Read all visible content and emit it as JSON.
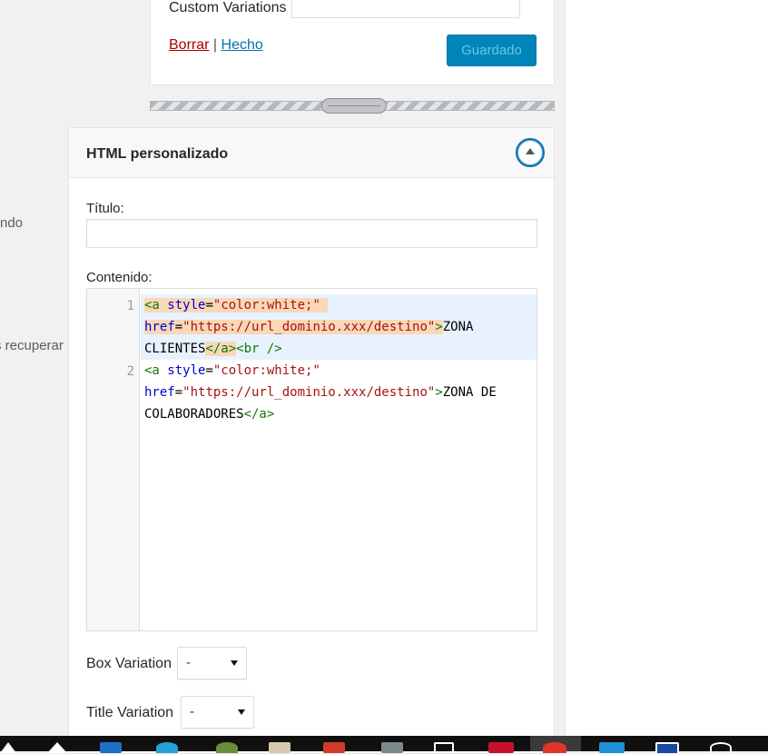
{
  "background_text": {
    "line1": "ndo",
    "line2": "s recuperar"
  },
  "previous_widget": {
    "custom_variations_label": "Custom Variations",
    "custom_variations_value": "",
    "delete_link": "Borrar",
    "separator": "|",
    "done_link": "Hecho",
    "save_button": "Guardado"
  },
  "widget": {
    "title": "HTML personalizado",
    "title_field_label": "Título:",
    "title_field_value": "",
    "content_field_label": "Contenido:",
    "box_variation_label": "Box Variation",
    "box_variation_value": "-",
    "title_variation_label": "Title Variation",
    "title_variation_value": "-"
  },
  "code_editor": {
    "line_numbers": [
      "1",
      "2"
    ],
    "lines": [
      {
        "row1": {
          "t1": "<a",
          "a1": " style",
          "e1": "=",
          "s1": "\"color:white;\" "
        },
        "row2": {
          "a1": "href",
          "e1": "=",
          "s1": "\"https://url_dominio.xxx/destino\"",
          "t1": ">",
          "x1": "ZONA"
        },
        "row3": {
          "x1": "CLIENTES",
          "t1": "</a>",
          "t2": "<br />"
        }
      },
      {
        "row1": {
          "t1": "<a",
          "a1": " style",
          "e1": "=",
          "s1": "\"color:white;\""
        },
        "row2": {
          "a1": "href",
          "e1": "=",
          "s1": "\"https://url_dominio.xxx/destino\"",
          "t1": ">",
          "x1": "ZONA DE"
        },
        "row3": {
          "x1": "COLABORADORES",
          "t1": "</a>"
        }
      }
    ]
  },
  "colors": {
    "accent": "#0073aa",
    "save_button_bg": "#0085ba",
    "delete_link": "#aa0000",
    "code_tag": "#117700",
    "code_attr": "#0000cc",
    "code_string": "#aa1111",
    "active_line": "#e8f2fe"
  },
  "taskbar_icons": [
    "windows-start-icon",
    "task-view-icon",
    "file-explorer-icon",
    "browser-icon",
    "chrome-icon",
    "app-icon",
    "office-icon",
    "app-icon",
    "app-icon",
    "app-icon",
    "app-icon",
    "app-icon",
    "app-icon"
  ]
}
